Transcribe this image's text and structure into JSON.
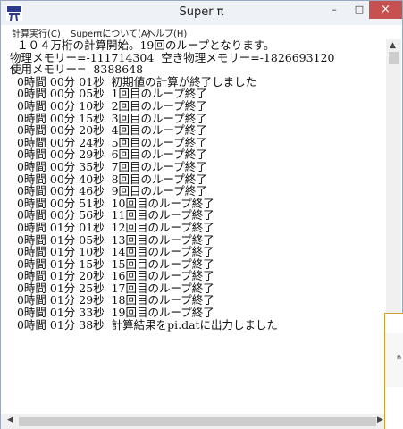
{
  "window": {
    "title": "Super π",
    "app_icon": "super-pi-app-icon",
    "controls": {
      "minimize": "–",
      "maximize": "□",
      "close": "×"
    }
  },
  "menu": [
    {
      "label": "計算実行(C)"
    },
    {
      "label": "Superπについて(A)"
    },
    {
      "label": "ヘルプ(H)"
    }
  ],
  "output_lines": [
    "  １０４万桁の計算開始。19回のループとなります。",
    "物理メモリー=-111714304  空き物理メモリー=-1826693120",
    "使用メモリー=  8388648",
    "  0時間 00分 01秒  初期値の計算が終了しました",
    "  0時間 00分 05秒  1回目のループ終了",
    "  0時間 00分 10秒  2回目のループ終了",
    "  0時間 00分 15秒  3回目のループ終了",
    "  0時間 00分 20秒  4回目のループ終了",
    "  0時間 00分 24秒  5回目のループ終了",
    "  0時間 00分 29秒  6回目のループ終了",
    "  0時間 00分 35秒  7回目のループ終了",
    "  0時間 00分 40秒  8回目のループ終了",
    "  0時間 00分 46秒  9回目のループ終了",
    "  0時間 00分 51秒  10回目のループ終了",
    "  0時間 00分 56秒  11回目のループ終了",
    "  0時間 01分 01秒  12回目のループ終了",
    "  0時間 01分 05秒  13回目のループ終了",
    "  0時間 01分 10秒  14回目のループ終了",
    "  0時間 01分 15秒  15回目のループ終了",
    "  0時間 01分 20秒  16回目のループ終了",
    "  0時間 01分 25秒  17回目のループ終了",
    "  0時間 01分 29秒  18回目のループ終了",
    "  0時間 01分 33秒  19回目のループ終了",
    "  0時間 01分 38秒  計算結果をpi.datに出力しました"
  ],
  "scrollbars": {
    "up": "▲",
    "left": "◀",
    "right": "▶"
  },
  "partial_dialog": {
    "text": "n"
  }
}
